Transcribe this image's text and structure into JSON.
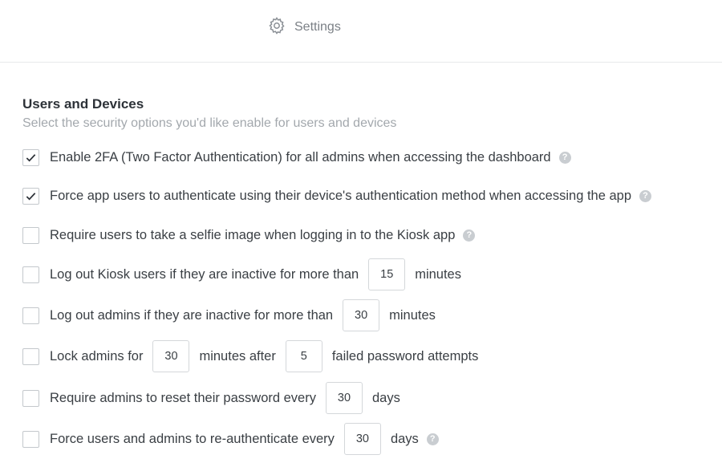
{
  "header": {
    "title": "Settings",
    "icon": "gear-icon"
  },
  "section": {
    "title": "Users and Devices",
    "subtitle": "Select the security options you'd like enable for users and devices"
  },
  "options": [
    {
      "checked": true,
      "text": "Enable 2FA (Two Factor Authentication) for all admins when accessing the dashboard",
      "help": true
    },
    {
      "checked": true,
      "text": "Force app users to authenticate using their device's authentication method when accessing the app",
      "help": true
    },
    {
      "checked": false,
      "text": "Require users to take a selfie image when logging in to the Kiosk app",
      "help": true
    },
    {
      "checked": false,
      "before": "Log out Kiosk users if they are inactive for more than",
      "value": "15",
      "after": "minutes"
    },
    {
      "checked": false,
      "before": "Log out admins if they are inactive for more than",
      "value": "30",
      "after": "minutes"
    },
    {
      "checked": false,
      "before": "Lock admins for",
      "value": "30",
      "middle": "minutes after",
      "value2": "5",
      "after": "failed password attempts"
    },
    {
      "checked": false,
      "before": "Require admins to reset their password every",
      "value": "30",
      "after": "days"
    },
    {
      "checked": false,
      "before": "Force users and admins to re-authenticate every",
      "value": "30",
      "after": "days",
      "help": true
    }
  ],
  "colors": {
    "accent": "#2d3238",
    "muted": "#a3a8ad",
    "border": "#c4c8cc"
  }
}
